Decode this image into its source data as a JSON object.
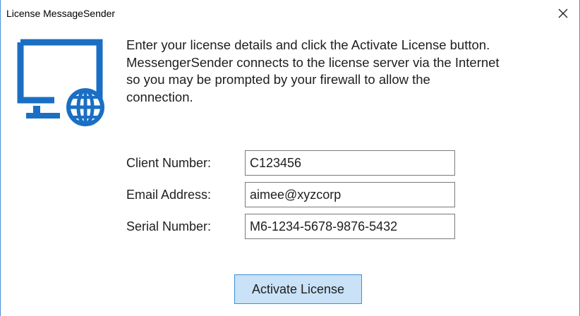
{
  "window": {
    "title": "License MessageSender",
    "close_icon": "close-icon"
  },
  "icon": {
    "name": "monitor-globe-icon",
    "color": "#1a6fc4"
  },
  "description": {
    "lines": [
      "Enter your license details and click the Activate License button.",
      "MessengerSender connects to the license server via the Internet",
      "so you may be prompted by your firewall to allow the",
      "connection."
    ]
  },
  "form": {
    "client_number": {
      "label": "Client Number:",
      "value": "C123456"
    },
    "email_address": {
      "label": "Email Address:",
      "value": "aimee@xyzcorp"
    },
    "serial_number": {
      "label": "Serial Number:",
      "value": "M6-1234-5678-9876-5432"
    }
  },
  "actions": {
    "activate_label": "Activate License"
  },
  "colors": {
    "accent": "#1a6fc4",
    "button_bg": "#c9e2f7",
    "button_border": "#3d8fd6"
  }
}
